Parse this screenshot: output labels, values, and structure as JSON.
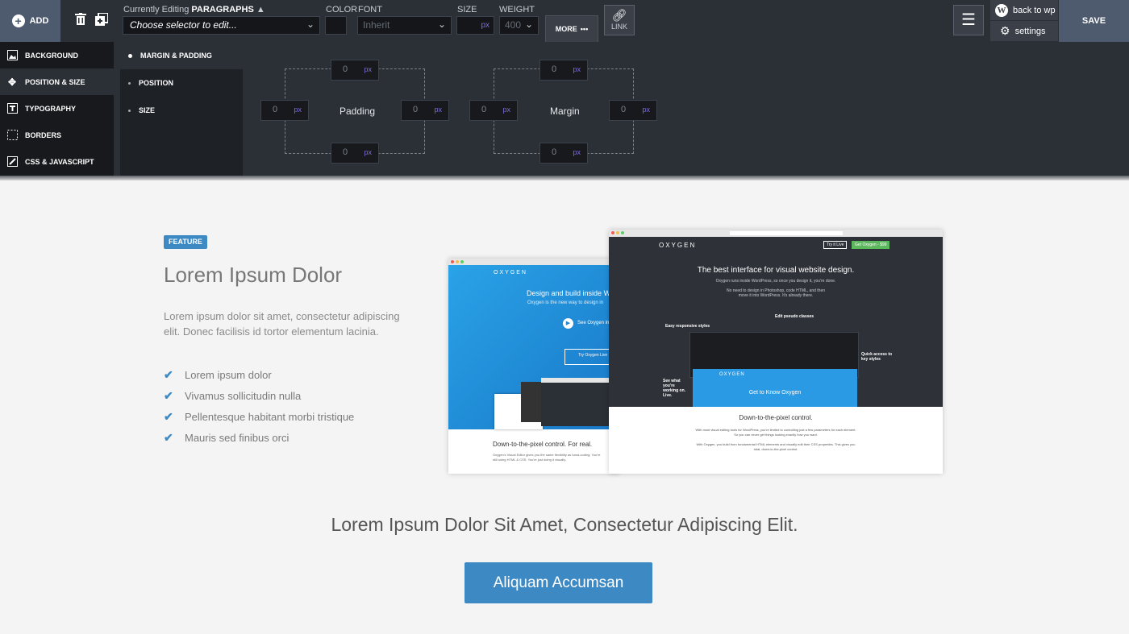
{
  "toolbar": {
    "add_label": "ADD",
    "editing_prefix": "Currently Editing",
    "editing_target": "PARAGRAPHS",
    "selector_placeholder": "Choose selector to edit...",
    "color_label": "COLOR",
    "font_label": "FONT",
    "font_value": "Inherit",
    "size_label": "SIZE",
    "size_unit": "px",
    "weight_label": "WEIGHT",
    "weight_value": "400",
    "more_label": "MORE",
    "link_label": "LINK",
    "back_to_wp_label": "back to wp",
    "settings_label": "settings",
    "save_label": "SAVE"
  },
  "side_nav": {
    "items": [
      {
        "label": "BACKGROUND",
        "icon": "image-icon"
      },
      {
        "label": "POSITION & SIZE",
        "icon": "move-icon"
      },
      {
        "label": "TYPOGRAPHY",
        "icon": "text-icon"
      },
      {
        "label": "BORDERS",
        "icon": "borders-icon"
      },
      {
        "label": "CSS & JAVASCRIPT",
        "icon": "code-icon"
      }
    ],
    "active": "POSITION & SIZE"
  },
  "sub_nav": {
    "items": [
      "MARGIN & PADDING",
      "POSITION",
      "SIZE"
    ],
    "active": "MARGIN & PADDING"
  },
  "spacing": {
    "padding_label": "Padding",
    "margin_label": "Margin",
    "unit": "px",
    "padding": {
      "top": "0",
      "right": "0",
      "bottom": "0",
      "left": "0"
    },
    "margin": {
      "top": "0",
      "right": "0",
      "bottom": "0",
      "left": "0"
    }
  },
  "content": {
    "badge": "FEATURE",
    "heading": "Lorem Ipsum Dolor",
    "paragraph": "Lorem ipsum dolor sit amet, consectetur adipiscing elit. Donec facilisis id tortor elementum lacinia.",
    "checklist": [
      "Lorem ipsum dolor",
      "Vivamus sollicitudin nulla",
      "Pellentesque habitant morbi tristique",
      "Mauris sed finibus orci"
    ],
    "tagline": "Lorem Ipsum Dolor Sit Amet, Consectetur Adipiscing Elit.",
    "cta_label": "Aliquam Accumsan"
  },
  "screenshots": {
    "back": {
      "brand": "OXYGEN",
      "headline": "Design and build inside Wo",
      "subline": "Oxygen is the new way to design in",
      "video_label": "See Oxygen in",
      "try_label": "Try Oxygen Live",
      "footer_title": "Down-to-the-pixel control. For real.",
      "footer_text": "Oxygen's Visual Editor gives you the same flexibility as hand-coding. You're still using HTML & CSS. You're just doing it visually."
    },
    "front": {
      "brand": "OXYGEN",
      "try_live": "Try it Live",
      "get_oxygen": "Get Oxygen - $99",
      "headline": "The best interface for visual website design.",
      "subline": "Oxygen runs inside WordPress, so once you design it, you're done.",
      "subline2": "No need to design in Photoshop, code HTML, and then move it into WordPress. It's already there.",
      "note_responsive": "Easy responsive styles",
      "note_pseudo": "Edit pseudo classes",
      "note_quick": "Quick access to key styles",
      "note_working": "See what you're working on. Live.",
      "inner_cta": "Get to Know Oxygen",
      "footer_title": "Down-to-the-pixel control.",
      "footer_text1": "With most visual editing tools for WordPress, you're limited to controlling just a few parameters for each element. So you can never get things looking exactly how you want.",
      "footer_text2": "With Oxygen, you build from fundamental HTML elements and visually edit their CSS properties. This gives you total, down-to-the-pixel control."
    }
  },
  "colors": {
    "accent": "#3d89c3",
    "toolbar_bg": "#2b2f36",
    "unit_purple": "#7d6cd8",
    "green_button": "#5cb85c"
  }
}
